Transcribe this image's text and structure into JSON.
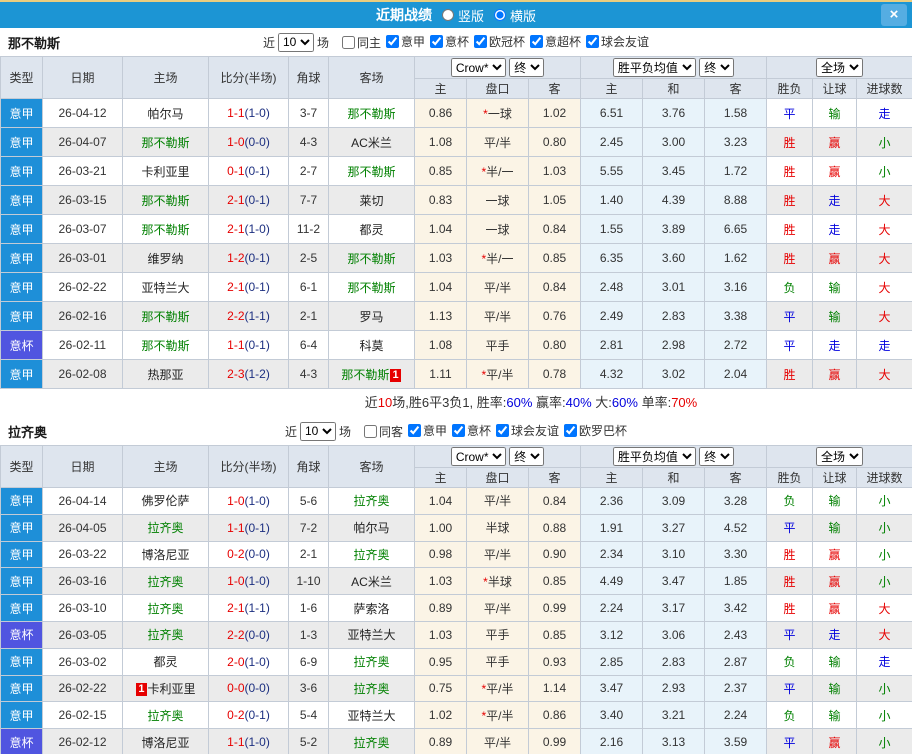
{
  "titlebar": {
    "title": "近期战绩",
    "vertical_label": "竖版",
    "horizontal_label": "横版",
    "vertical_selected": false,
    "horizontal_selected": true,
    "close_label": "×"
  },
  "colors": {
    "titlebar_blue": "#1c95d4",
    "top_strip_gold": "#eacd7f",
    "focus_team_green": "#008000",
    "score_red": "#e60000",
    "half_score_navy": "#1c2f80",
    "win_red": "#e60000",
    "draw_blue": "#0000dd",
    "lose_green": "#008000",
    "handicap_col_bg": "#fbf4e6",
    "europe_col_bg": "#e8f3fa",
    "zebra_gray": "#ebebeb"
  },
  "league_colors": {
    "意甲": "#1e8fd8",
    "意杯": "#5055e0"
  },
  "result_color_map": {
    "胜": "c-red",
    "平": "c-blue",
    "负": "c-green",
    "赢": "c-red",
    "走": "c-blue",
    "输": "c-green",
    "大": "c-red",
    "小": "c-green"
  },
  "columns": {
    "type": "类型",
    "date": "日期",
    "home": "主场",
    "score": "比分(半场)",
    "corner": "角球",
    "away": "客场",
    "h_home": "主",
    "h_line": "盘口",
    "h_away": "客",
    "e_home": "主",
    "e_draw": "和",
    "e_away": "客",
    "result": "胜负",
    "handicap_result": "让球",
    "goals": "进球数"
  },
  "header_controls": {
    "bookmaker": "Crow*",
    "final_left": "终",
    "europe_mean": "胜平负均值",
    "final_right": "终",
    "scope": "全场"
  },
  "sections": [
    {
      "team": "那不勒斯",
      "filter": {
        "recent_label": "近",
        "recent_value": "10",
        "games_label": "场",
        "venue_label": "同主",
        "venue_checked": false,
        "leagues": [
          {
            "label": "意甲",
            "checked": true
          },
          {
            "label": "意杯",
            "checked": true
          },
          {
            "label": "欧冠杯",
            "checked": true
          },
          {
            "label": "意超杯",
            "checked": true
          },
          {
            "label": "球会友谊",
            "checked": true
          }
        ]
      },
      "rows": [
        {
          "league": "意甲",
          "date": "26-04-12",
          "home": "帕尔马",
          "score": "1-1",
          "half": "1-0",
          "corner": "3-7",
          "away": "那不勒斯",
          "ah": [
            "0.86",
            "*一球",
            "1.02"
          ],
          "eu": [
            "6.51",
            "3.76",
            "1.58"
          ],
          "res": [
            "平",
            "输",
            "走"
          ]
        },
        {
          "league": "意甲",
          "date": "26-04-07",
          "home": "那不勒斯",
          "score": "1-0",
          "half": "0-0",
          "corner": "4-3",
          "away": "AC米兰",
          "ah": [
            "1.08",
            "平/半",
            "0.80"
          ],
          "eu": [
            "2.45",
            "3.00",
            "3.23"
          ],
          "res": [
            "胜",
            "赢",
            "小"
          ]
        },
        {
          "league": "意甲",
          "date": "26-03-21",
          "home": "卡利亚里",
          "score": "0-1",
          "half": "0-1",
          "corner": "2-7",
          "away": "那不勒斯",
          "ah": [
            "0.85",
            "*半/一",
            "1.03"
          ],
          "eu": [
            "5.55",
            "3.45",
            "1.72"
          ],
          "res": [
            "胜",
            "赢",
            "小"
          ]
        },
        {
          "league": "意甲",
          "date": "26-03-15",
          "home": "那不勒斯",
          "score": "2-1",
          "half": "0-1",
          "corner": "7-7",
          "away": "莱切",
          "ah": [
            "0.83",
            "一球",
            "1.05"
          ],
          "eu": [
            "1.40",
            "4.39",
            "8.88"
          ],
          "res": [
            "胜",
            "走",
            "大"
          ]
        },
        {
          "league": "意甲",
          "date": "26-03-07",
          "home": "那不勒斯",
          "score": "2-1",
          "half": "1-0",
          "corner": "11-2",
          "away": "都灵",
          "ah": [
            "1.04",
            "一球",
            "0.84"
          ],
          "eu": [
            "1.55",
            "3.89",
            "6.65"
          ],
          "res": [
            "胜",
            "走",
            "大"
          ]
        },
        {
          "league": "意甲",
          "date": "26-03-01",
          "home": "维罗纳",
          "score": "1-2",
          "half": "0-1",
          "corner": "2-5",
          "away": "那不勒斯",
          "ah": [
            "1.03",
            "*半/一",
            "0.85"
          ],
          "eu": [
            "6.35",
            "3.60",
            "1.62"
          ],
          "res": [
            "胜",
            "赢",
            "大"
          ]
        },
        {
          "league": "意甲",
          "date": "26-02-22",
          "home": "亚特兰大",
          "score": "2-1",
          "half": "0-1",
          "corner": "6-1",
          "away": "那不勒斯",
          "ah": [
            "1.04",
            "平/半",
            "0.84"
          ],
          "eu": [
            "2.48",
            "3.01",
            "3.16"
          ],
          "res": [
            "负",
            "输",
            "大"
          ]
        },
        {
          "league": "意甲",
          "date": "26-02-16",
          "home": "那不勒斯",
          "score": "2-2",
          "half": "1-1",
          "corner": "2-1",
          "away": "罗马",
          "ah": [
            "1.13",
            "平/半",
            "0.76"
          ],
          "eu": [
            "2.49",
            "2.83",
            "3.38"
          ],
          "res": [
            "平",
            "输",
            "大"
          ]
        },
        {
          "league": "意杯",
          "date": "26-02-11",
          "home": "那不勒斯",
          "score": "1-1",
          "half": "0-1",
          "corner": "6-4",
          "away": "科莫",
          "ah": [
            "1.08",
            "平手",
            "0.80"
          ],
          "eu": [
            "2.81",
            "2.98",
            "2.72"
          ],
          "res": [
            "平",
            "走",
            "走"
          ]
        },
        {
          "league": "意甲",
          "date": "26-02-08",
          "home": "热那亚",
          "score": "2-3",
          "half": "1-2",
          "corner": "4-3",
          "away": "那不勒斯",
          "away_card": "1",
          "ah": [
            "1.11",
            "*平/半",
            "0.78"
          ],
          "eu": [
            "4.32",
            "3.02",
            "2.04"
          ],
          "res": [
            "胜",
            "赢",
            "大"
          ]
        }
      ],
      "summary": [
        {
          "text": "近",
          "cls": "dark"
        },
        {
          "text": "10",
          "cls": "red"
        },
        {
          "text": "场,胜6平3负1, 胜率:",
          "cls": "dark"
        },
        {
          "text": "60%",
          "cls": "blue"
        },
        {
          "text": " 赢率:",
          "cls": "dark"
        },
        {
          "text": "40%",
          "cls": "blue"
        },
        {
          "text": " 大:",
          "cls": "dark"
        },
        {
          "text": "60%",
          "cls": "blue"
        },
        {
          "text": " 单率:",
          "cls": "dark"
        },
        {
          "text": "70%",
          "cls": "red"
        }
      ]
    },
    {
      "team": "拉齐奥",
      "filter": {
        "recent_label": "近",
        "recent_value": "10",
        "games_label": "场",
        "venue_label": "同客",
        "venue_checked": false,
        "leagues": [
          {
            "label": "意甲",
            "checked": true
          },
          {
            "label": "意杯",
            "checked": true
          },
          {
            "label": "球会友谊",
            "checked": true
          },
          {
            "label": "欧罗巴杯",
            "checked": true
          }
        ]
      },
      "rows": [
        {
          "league": "意甲",
          "date": "26-04-14",
          "home": "佛罗伦萨",
          "score": "1-0",
          "half": "1-0",
          "corner": "5-6",
          "away": "拉齐奥",
          "ah": [
            "1.04",
            "平/半",
            "0.84"
          ],
          "eu": [
            "2.36",
            "3.09",
            "3.28"
          ],
          "res": [
            "负",
            "输",
            "小"
          ]
        },
        {
          "league": "意甲",
          "date": "26-04-05",
          "home": "拉齐奥",
          "score": "1-1",
          "half": "0-1",
          "corner": "7-2",
          "away": "帕尔马",
          "ah": [
            "1.00",
            "半球",
            "0.88"
          ],
          "eu": [
            "1.91",
            "3.27",
            "4.52"
          ],
          "res": [
            "平",
            "输",
            "小"
          ]
        },
        {
          "league": "意甲",
          "date": "26-03-22",
          "home": "博洛尼亚",
          "score": "0-2",
          "half": "0-0",
          "corner": "2-1",
          "away": "拉齐奥",
          "ah": [
            "0.98",
            "平/半",
            "0.90"
          ],
          "eu": [
            "2.34",
            "3.10",
            "3.30"
          ],
          "res": [
            "胜",
            "赢",
            "小"
          ]
        },
        {
          "league": "意甲",
          "date": "26-03-16",
          "home": "拉齐奥",
          "score": "1-0",
          "half": "1-0",
          "corner": "1-10",
          "away": "AC米兰",
          "ah": [
            "1.03",
            "*半球",
            "0.85"
          ],
          "eu": [
            "4.49",
            "3.47",
            "1.85"
          ],
          "res": [
            "胜",
            "赢",
            "小"
          ]
        },
        {
          "league": "意甲",
          "date": "26-03-10",
          "home": "拉齐奥",
          "score": "2-1",
          "half": "1-1",
          "corner": "1-6",
          "away": "萨索洛",
          "ah": [
            "0.89",
            "平/半",
            "0.99"
          ],
          "eu": [
            "2.24",
            "3.17",
            "3.42"
          ],
          "res": [
            "胜",
            "赢",
            "大"
          ]
        },
        {
          "league": "意杯",
          "date": "26-03-05",
          "home": "拉齐奥",
          "score": "2-2",
          "half": "0-0",
          "corner": "1-3",
          "away": "亚特兰大",
          "ah": [
            "1.03",
            "平手",
            "0.85"
          ],
          "eu": [
            "3.12",
            "3.06",
            "2.43"
          ],
          "res": [
            "平",
            "走",
            "大"
          ]
        },
        {
          "league": "意甲",
          "date": "26-03-02",
          "home": "都灵",
          "score": "2-0",
          "half": "1-0",
          "corner": "6-9",
          "away": "拉齐奥",
          "ah": [
            "0.95",
            "平手",
            "0.93"
          ],
          "eu": [
            "2.85",
            "2.83",
            "2.87"
          ],
          "res": [
            "负",
            "输",
            "走"
          ]
        },
        {
          "league": "意甲",
          "date": "26-02-22",
          "home": "卡利亚里",
          "home_card": "1",
          "score": "0-0",
          "half": "0-0",
          "corner": "3-6",
          "away": "拉齐奥",
          "ah": [
            "0.75",
            "*平/半",
            "1.14"
          ],
          "eu": [
            "3.47",
            "2.93",
            "2.37"
          ],
          "res": [
            "平",
            "输",
            "小"
          ]
        },
        {
          "league": "意甲",
          "date": "26-02-15",
          "home": "拉齐奥",
          "score": "0-2",
          "half": "0-1",
          "corner": "5-4",
          "away": "亚特兰大",
          "ah": [
            "1.02",
            "*平/半",
            "0.86"
          ],
          "eu": [
            "3.40",
            "3.21",
            "2.24"
          ],
          "res": [
            "负",
            "输",
            "小"
          ]
        },
        {
          "league": "意杯",
          "date": "26-02-12",
          "home": "博洛尼亚",
          "score": "1-1",
          "half": "1-0",
          "corner": "5-2",
          "away": "拉齐奥",
          "ah": [
            "0.89",
            "平/半",
            "0.99"
          ],
          "eu": [
            "2.16",
            "3.13",
            "3.59"
          ],
          "res": [
            "平",
            "赢",
            "小"
          ]
        }
      ]
    }
  ]
}
